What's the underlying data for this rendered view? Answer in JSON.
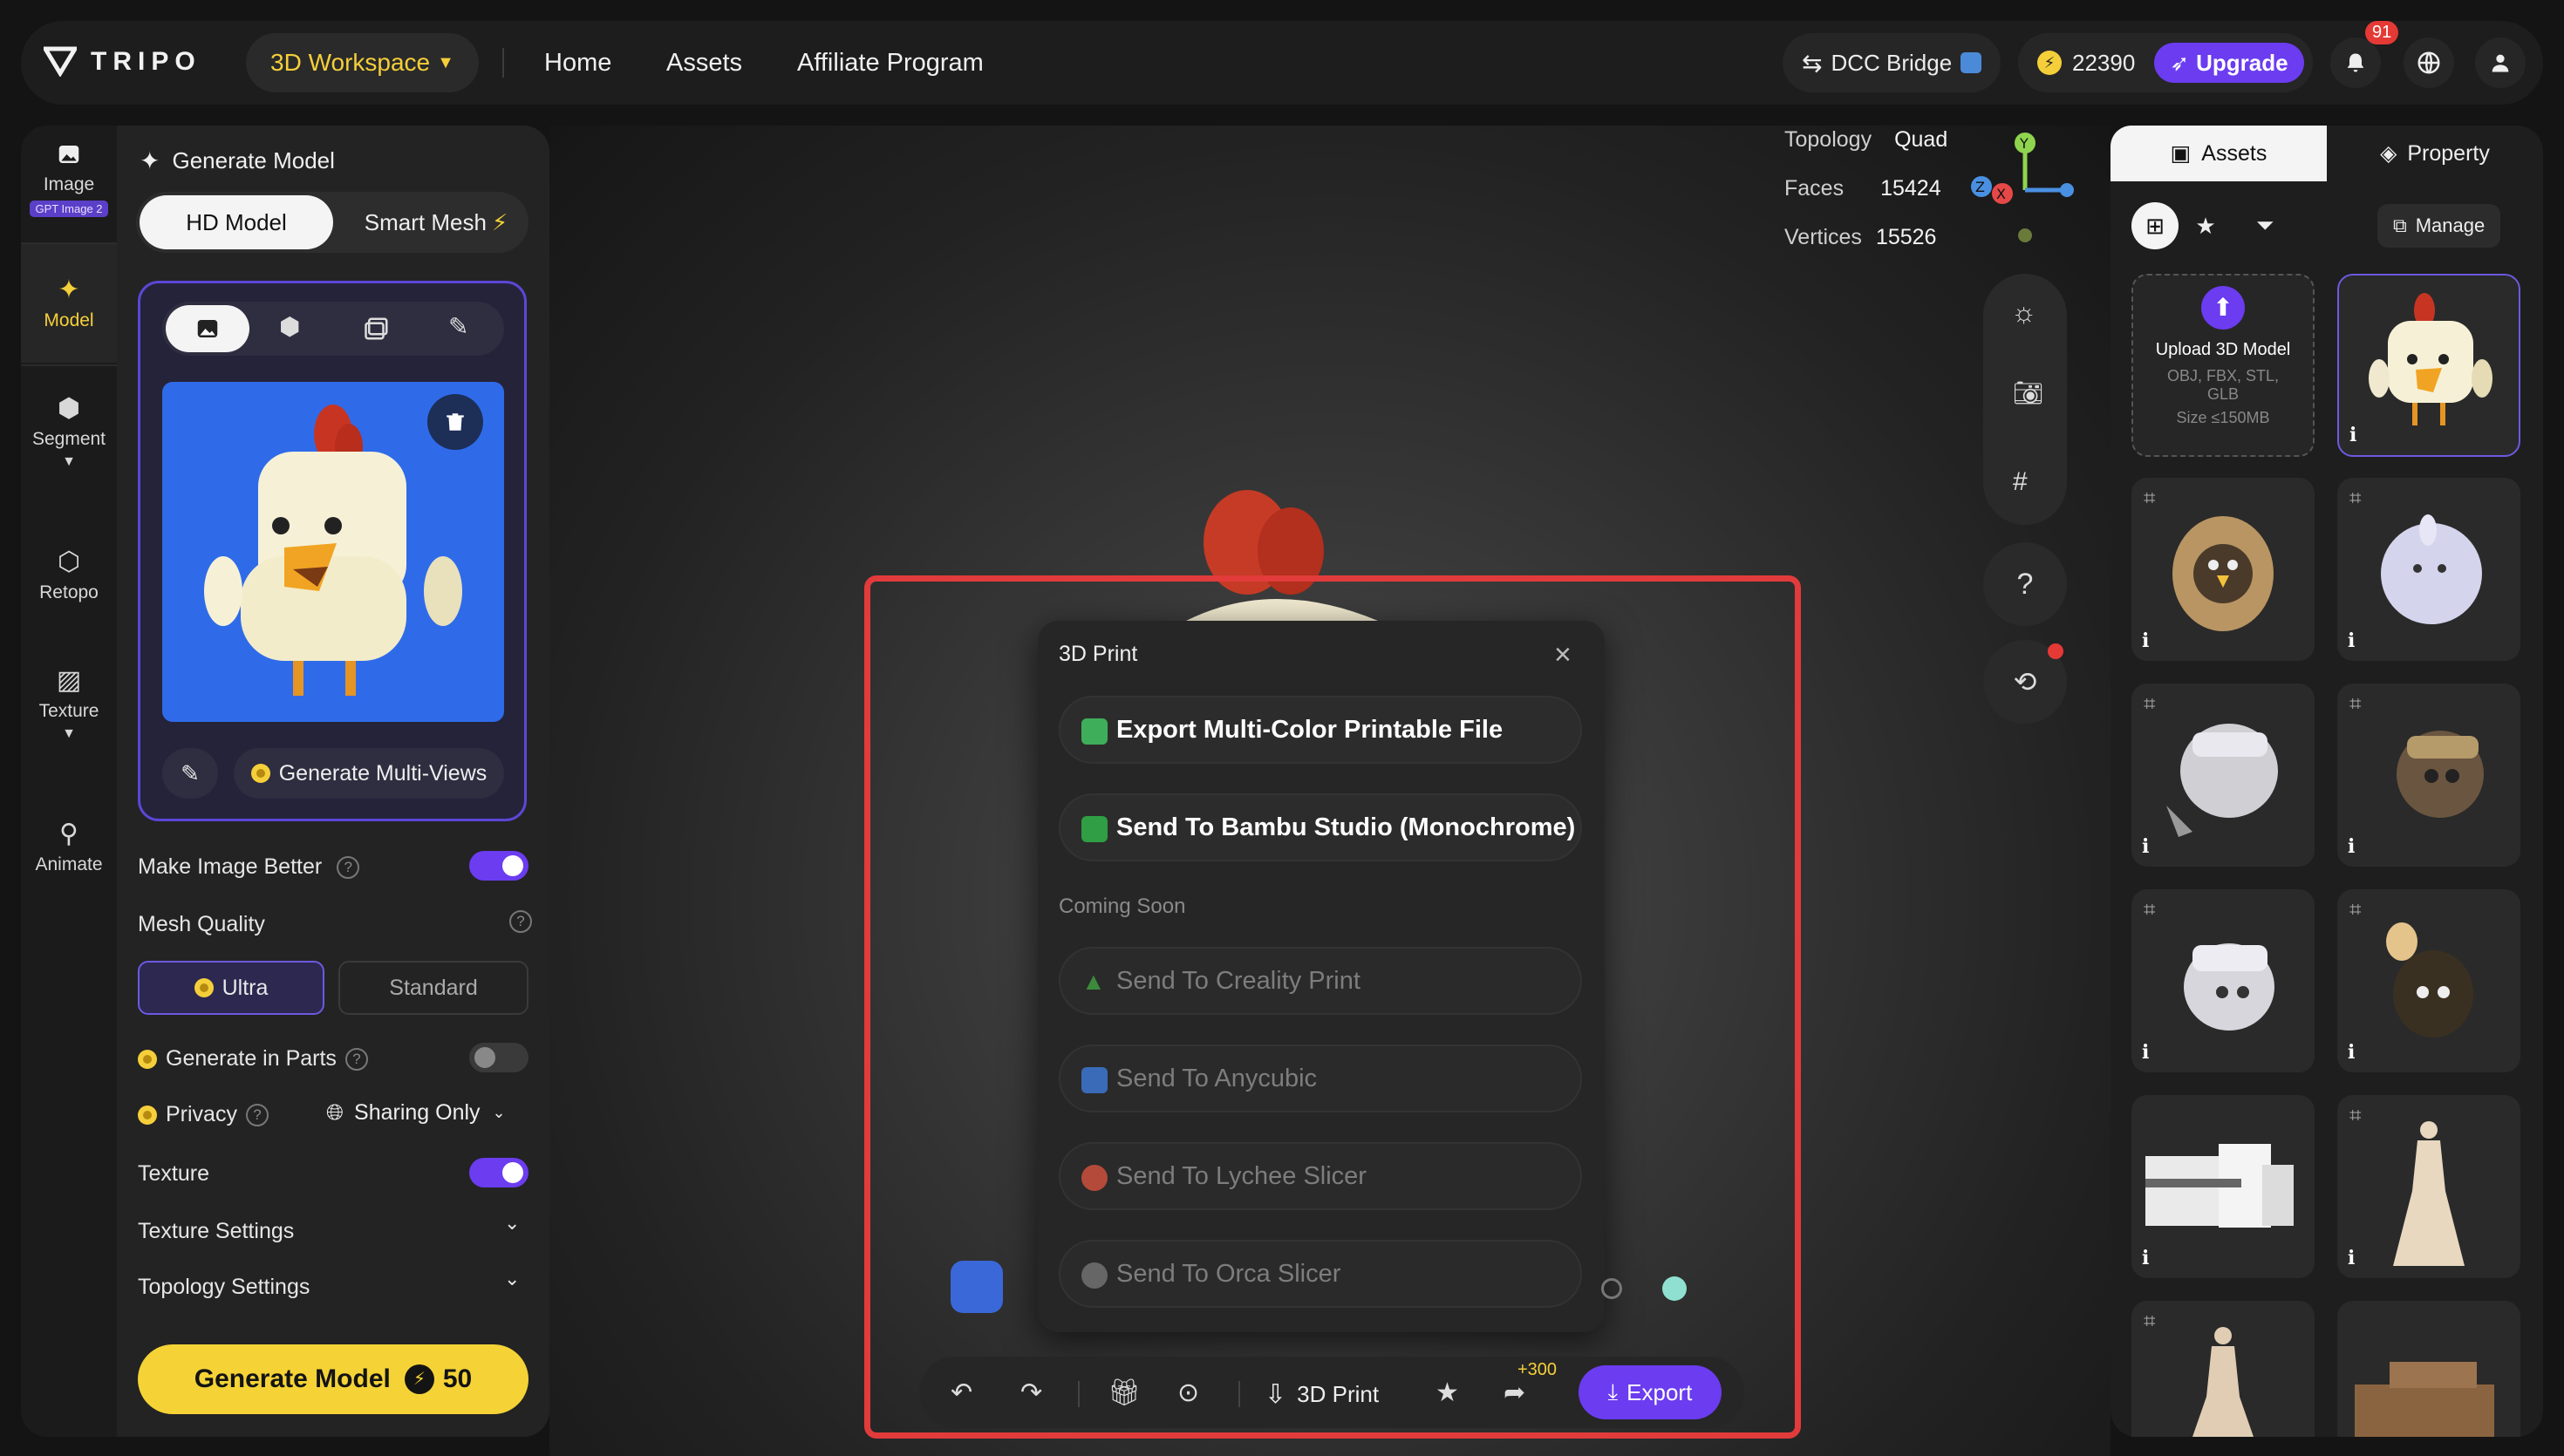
{
  "app": {
    "name": "TRIPO"
  },
  "topbar": {
    "workspace_label": "3D Workspace",
    "nav": [
      "Home",
      "Assets",
      "Affiliate Program"
    ],
    "dcc_bridge": "DCC Bridge",
    "credits": "22390",
    "upgrade_label": "Upgrade",
    "notifications": "91"
  },
  "rail": {
    "items": [
      {
        "label": "Image",
        "tag": "GPT Image 2"
      },
      {
        "label": "Model"
      },
      {
        "label": "Segment"
      },
      {
        "label": "Retopo"
      },
      {
        "label": "Texture"
      },
      {
        "label": "Animate"
      }
    ]
  },
  "panel": {
    "title": "Generate Model",
    "modes": [
      "HD Model",
      "Smart Mesh"
    ],
    "multi_views": "Generate Multi-Views",
    "make_better": "Make Image Better",
    "make_better_on": true,
    "mesh_quality": "Mesh Quality",
    "quality_options": [
      "Ultra",
      "Standard"
    ],
    "gen_parts": "Generate in Parts",
    "gen_parts_on": false,
    "privacy": "Privacy",
    "privacy_value": "Sharing Only",
    "texture": "Texture",
    "texture_on": true,
    "texture_settings": "Texture Settings",
    "topology_settings": "Topology Settings",
    "generate_label": "Generate Model",
    "generate_cost": "50"
  },
  "stats": {
    "topology_label": "Topology",
    "topology": "Quad",
    "faces_label": "Faces",
    "faces": "15424",
    "vertices_label": "Vertices",
    "vertices": "15526"
  },
  "modal": {
    "title": "3D Print",
    "active_options": [
      "Export Multi-Color Printable File",
      "Send To Bambu Studio (Monochrome)"
    ],
    "coming_soon_label": "Coming Soon",
    "soon_options": [
      "Send To Creality Print",
      "Send To Anycubic",
      "Send To Lychee Slicer",
      "Send To Orca Slicer"
    ]
  },
  "toolbar": {
    "print_label": "3D Print",
    "bonus": "+300",
    "export_label": "Export"
  },
  "right": {
    "tabs": [
      "Assets",
      "Property"
    ],
    "manage_label": "Manage",
    "upload_title": "Upload 3D Model",
    "upload_formats": "OBJ, FBX, STL, GLB",
    "upload_size": "Size ≤150MB",
    "info_glyph": "i"
  },
  "colors": {
    "accent": "#6b3cf0",
    "brand_yellow": "#f5d336",
    "highlight": "#e23b3b"
  }
}
